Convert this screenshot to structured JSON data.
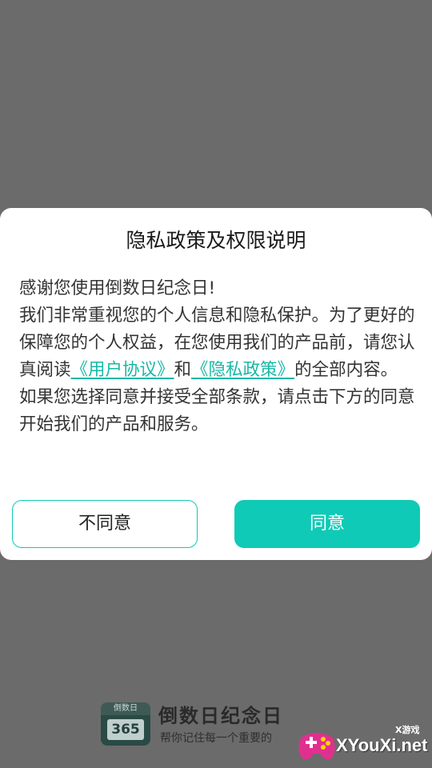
{
  "dialog": {
    "title": "隐私政策及权限说明",
    "greeting": "感谢您使用倒数日纪念日!",
    "para_prefix": "我们非常重视您的个人信息和隐私保护。为了更好的保障您的个人权益，在您使用我们的产品前，请您认真阅读",
    "user_agreement_link": "《用户协议》",
    "and_text": "和",
    "privacy_policy_link": "《隐私政策》",
    "para_suffix": "的全部内容。",
    "consent_text": "如果您选择同意并接受全部条款，请点击下方的同意开始我们的产品和服务。",
    "disagree_label": "不同意",
    "agree_label": "同意"
  },
  "splash": {
    "logo_top": "倒数日",
    "logo_number": "365",
    "app_name": "倒数日纪念日",
    "slogan": "帮你记住每一个重要的"
  },
  "watermark": {
    "small_text": "X游戏",
    "site_text": "XYouXi.net"
  },
  "colors": {
    "accent": "#0fcab6",
    "link": "#17b8a6",
    "backdrop": "#6b6b6b"
  }
}
